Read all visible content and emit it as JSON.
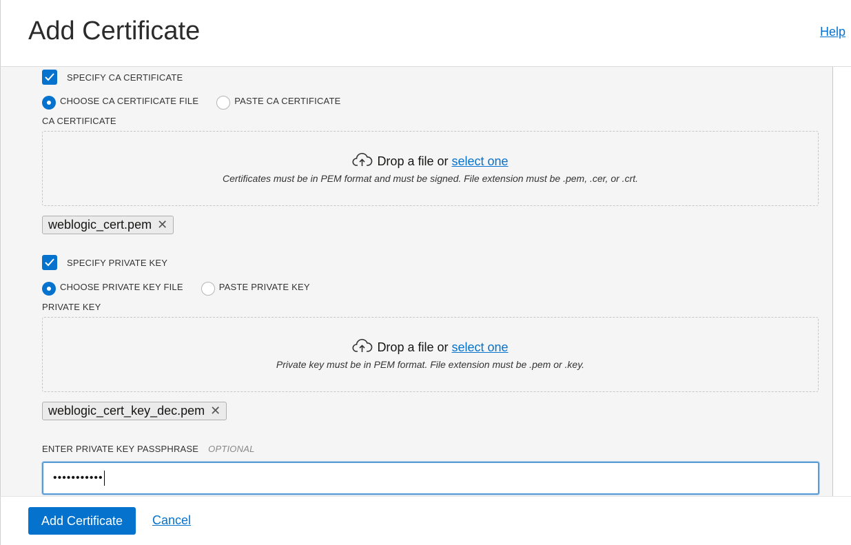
{
  "header": {
    "title": "Add Certificate",
    "help_label": "Help"
  },
  "ca": {
    "checkbox_label": "SPECIFY CA CERTIFICATE",
    "checked": true,
    "radio_choose_label": "CHOOSE CA CERTIFICATE FILE",
    "radio_paste_label": "PASTE CA CERTIFICATE",
    "selected": "choose",
    "field_label": "CA CERTIFICATE",
    "drop_text": "Drop a file or",
    "drop_link": "select one",
    "drop_hint": "Certificates must be in PEM format and must be signed. File extension must be .pem, .cer, or .crt.",
    "file_name": "weblogic_cert.pem"
  },
  "key": {
    "checkbox_label": "SPECIFY PRIVATE KEY",
    "checked": true,
    "radio_choose_label": "CHOOSE PRIVATE KEY FILE",
    "radio_paste_label": "PASTE PRIVATE KEY",
    "selected": "choose",
    "field_label": "PRIVATE KEY",
    "drop_text": "Drop a file or",
    "drop_link": "select one",
    "drop_hint": "Private key must be in PEM format. File extension must be .pem or .key.",
    "file_name": "weblogic_cert_key_dec.pem"
  },
  "passphrase": {
    "label": "ENTER PRIVATE KEY PASSPHRASE",
    "optional": "OPTIONAL",
    "value": "•••••••••••"
  },
  "footer": {
    "submit_label": "Add Certificate",
    "cancel_label": "Cancel"
  },
  "colors": {
    "accent": "#0572ce",
    "panel_bg": "#f5f5f5"
  }
}
